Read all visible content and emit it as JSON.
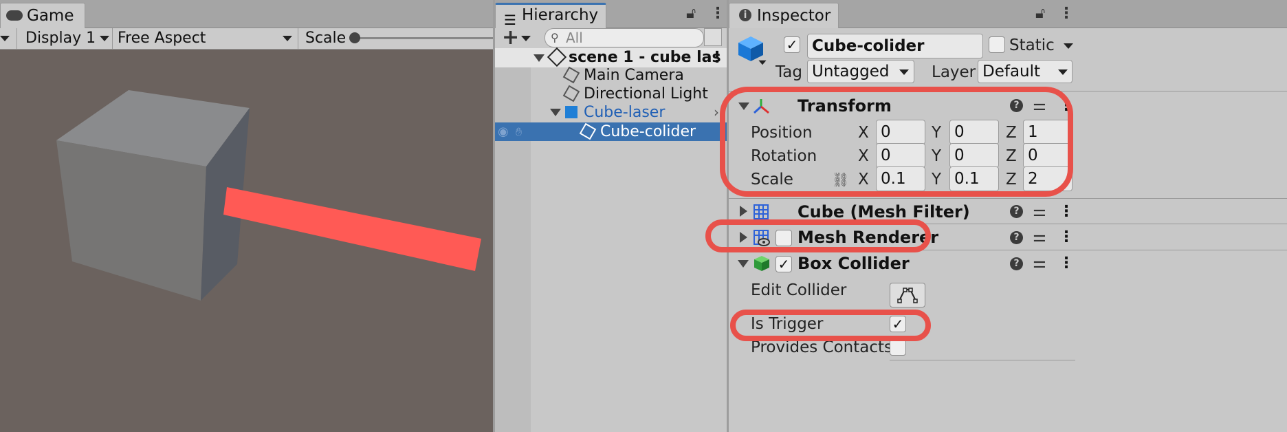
{
  "game": {
    "tab": "Game",
    "display": "Display 1",
    "aspect": "Free Aspect",
    "scale_label": "Scale",
    "colors": {
      "background": "#6b625e",
      "cube_front": "#767574",
      "cube_top": "#8a8b8d",
      "cube_side": "#585c64",
      "laser": "#ff5a55"
    }
  },
  "hierarchy": {
    "tab": "Hierarchy",
    "search_placeholder": "All",
    "scene": "scene 1 - cube las",
    "items": [
      {
        "label": "Main Camera"
      },
      {
        "label": "Directional Light"
      },
      {
        "label": "Cube-laser"
      },
      {
        "label": "Cube-colider"
      }
    ]
  },
  "inspector": {
    "tab": "Inspector",
    "object_name": "Cube-colider",
    "active": true,
    "static_label": "Static",
    "static_checked": false,
    "tag_label": "Tag",
    "tag_value": "Untagged",
    "layer_label": "Layer",
    "layer_value": "Default",
    "transform": {
      "title": "Transform",
      "rows": [
        {
          "label": "Position",
          "x": "0",
          "y": "0",
          "z": "1"
        },
        {
          "label": "Rotation",
          "x": "0",
          "y": "0",
          "z": "0"
        },
        {
          "label": "Scale",
          "x": "0.1",
          "y": "0.1",
          "z": "2"
        }
      ],
      "axis": {
        "x": "X",
        "y": "Y",
        "z": "Z"
      }
    },
    "mesh_filter": {
      "title": "Cube (Mesh Filter)"
    },
    "mesh_renderer": {
      "title": "Mesh Renderer",
      "enabled": false
    },
    "box_collider": {
      "title": "Box Collider",
      "enabled": true,
      "edit_collider": "Edit Collider",
      "is_trigger": "Is Trigger",
      "is_trigger_checked": true,
      "provides_contacts": "Provides Contacts",
      "provides_contacts_checked": false
    },
    "checkmark": "✓",
    "help_icon": "?"
  },
  "colors": {
    "highlight": "#e8514a",
    "selection": "#3a72b0",
    "link_blue": "#1f5fb5"
  }
}
